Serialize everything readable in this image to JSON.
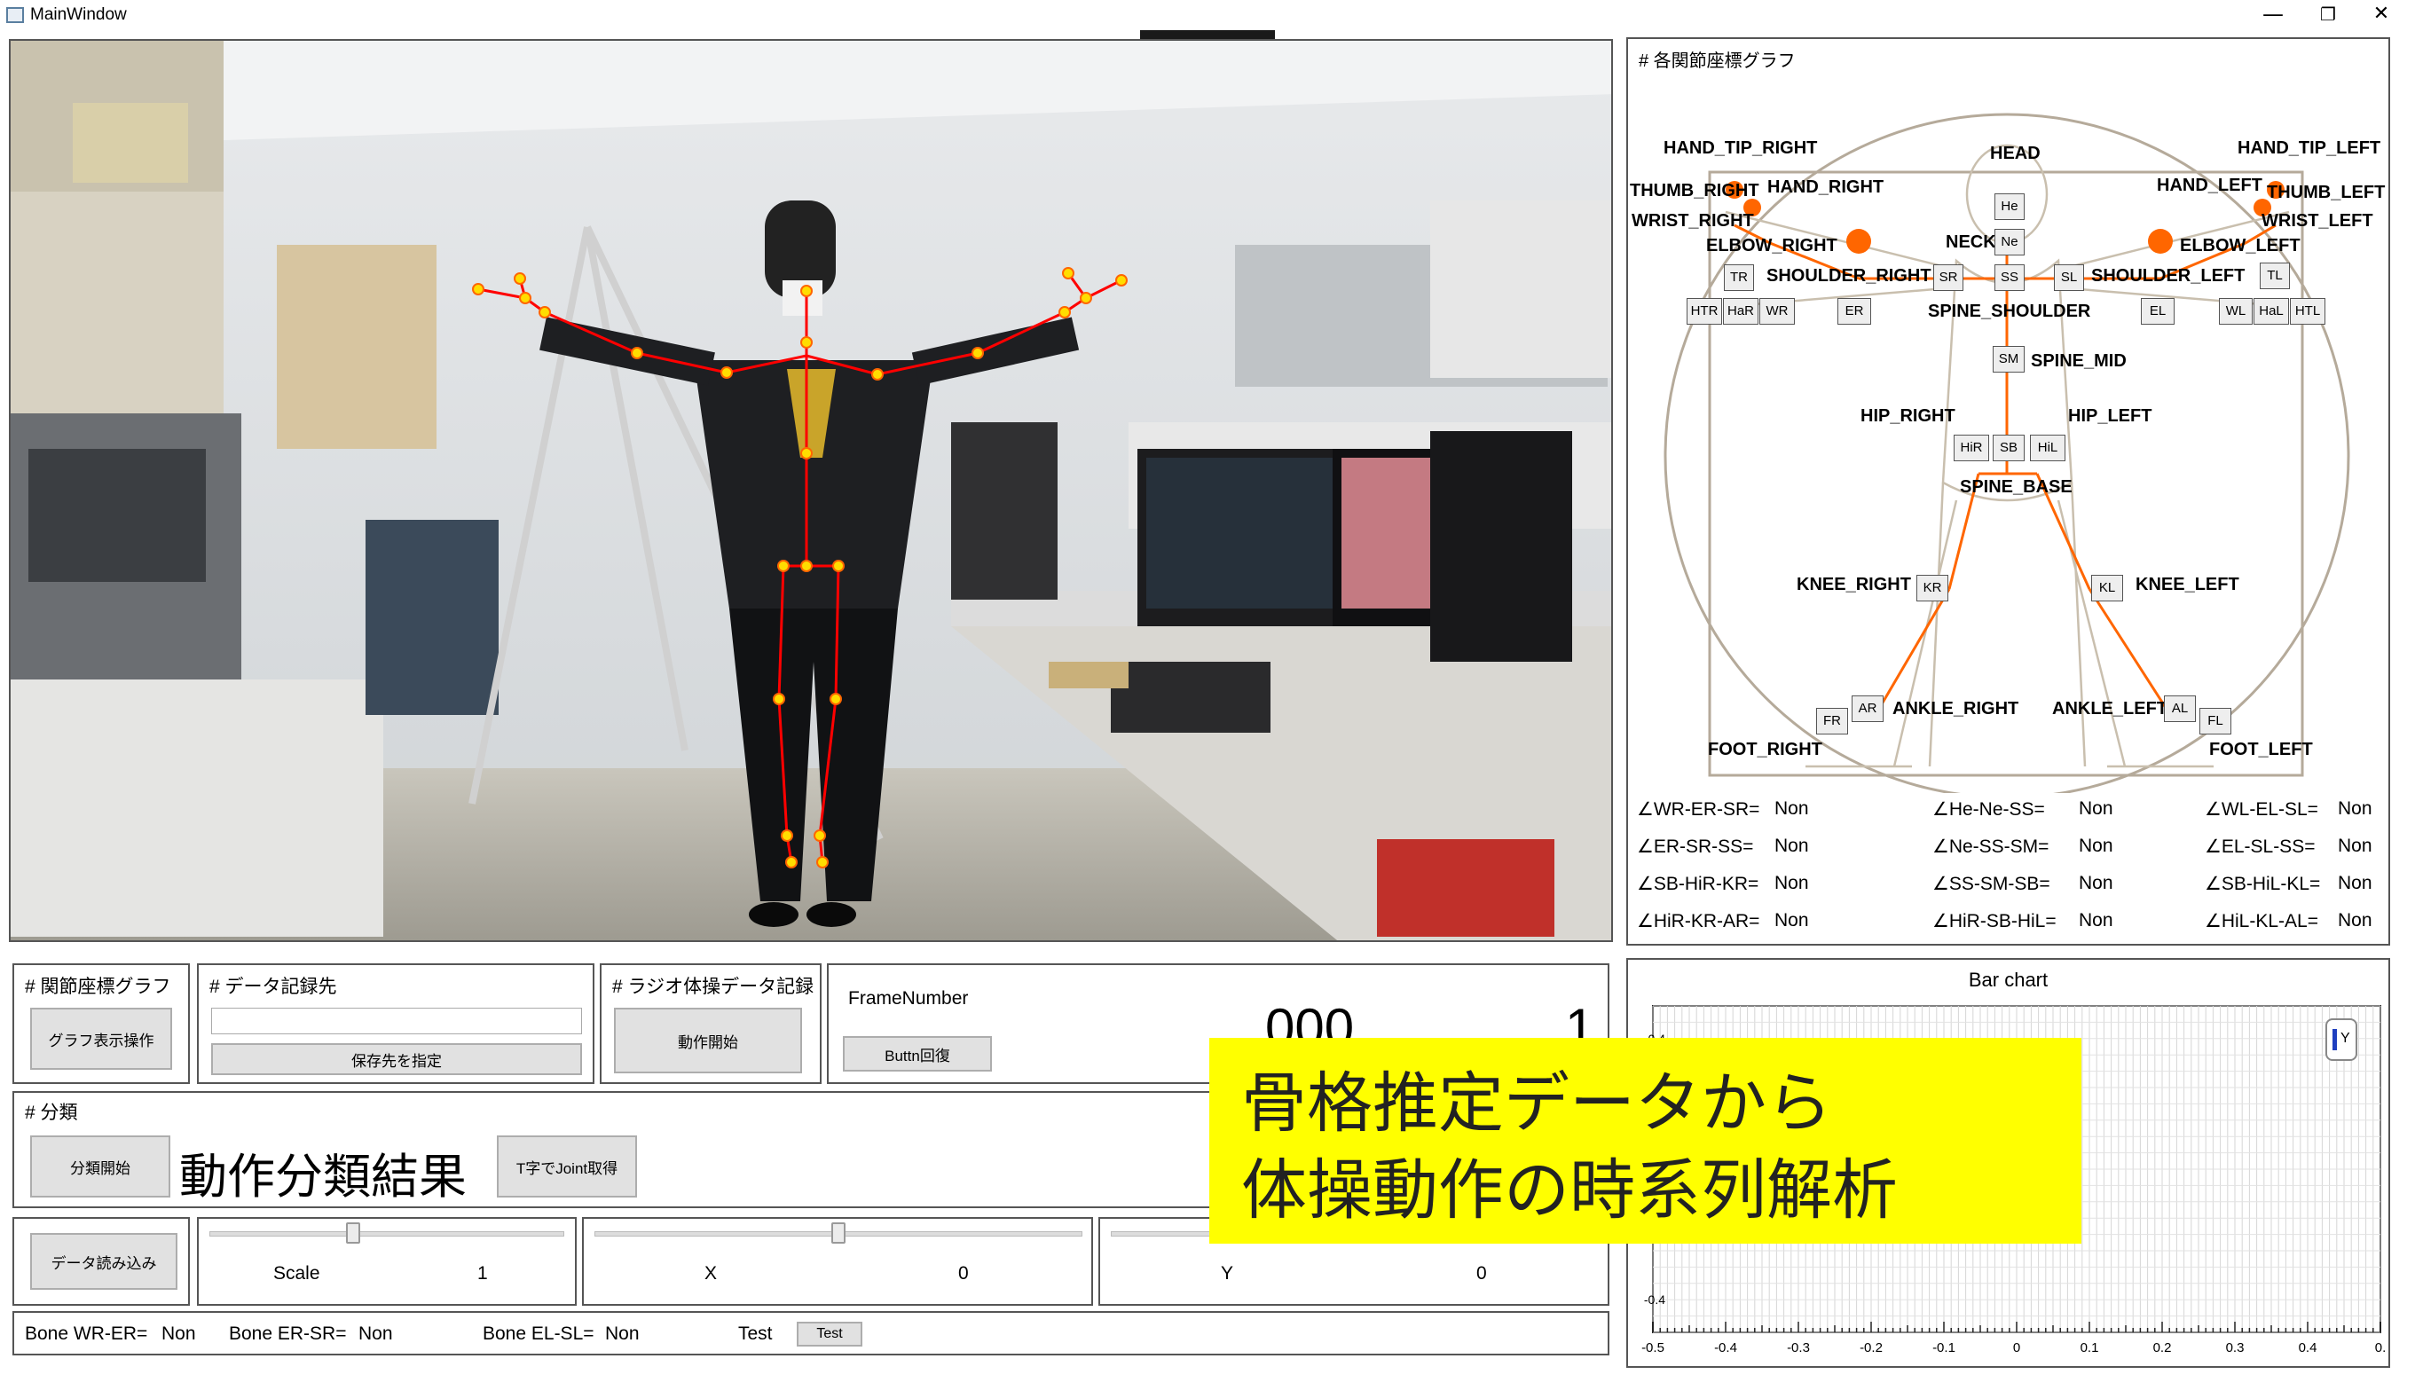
{
  "window": {
    "title": "MainWindow",
    "minimize": "—",
    "restore": "❐",
    "close": "✕"
  },
  "overlay": {
    "line1": "骨格推定データから",
    "line2": "体操動作の時系列解析",
    "bg": "#ffff00"
  },
  "joint_panel": {
    "header": "# 各関節座標グラフ",
    "labels": {
      "hand_tip_right": "HAND_TIP_RIGHT",
      "hand_tip_left": "HAND_TIP_LEFT",
      "head": "HEAD",
      "thumb_right": "THUMB_RIGHT",
      "hand_right": "HAND_RIGHT",
      "hand_left": "HAND_LEFT",
      "thumb_left": "THUMB_LEFT",
      "wrist_right": "WRIST_RIGHT",
      "wrist_left": "WRIST_LEFT",
      "neck": "NECK",
      "elbow_right": "ELBOW_RIGHT",
      "elbow_left": "ELBOW_LEFT",
      "shoulder_right": "SHOULDER_RIGHT",
      "shoulder_left": "SHOULDER_LEFT",
      "spine_shoulder": "SPINE_SHOULDER",
      "spine_mid": "SPINE_MID",
      "hip_right": "HIP_RIGHT",
      "hip_left": "HIP_LEFT",
      "spine_base": "SPINE_BASE",
      "knee_right": "KNEE_RIGHT",
      "knee_left": "KNEE_LEFT",
      "ankle_right": "ANKLE_RIGHT",
      "ankle_left": "ANKLE_LEFT",
      "foot_right": "FOOT_RIGHT",
      "foot_left": "FOOT_LEFT"
    },
    "boxes": {
      "he": "He",
      "ne": "Ne",
      "ss": "SS",
      "sr": "SR",
      "sl": "SL",
      "tr": "TR",
      "tl": "TL",
      "htr": "HTR",
      "har": "HaR",
      "wr": "WR",
      "er": "ER",
      "el": "EL",
      "wl": "WL",
      "hal": "HaL",
      "htl": "HTL",
      "sm": "SM",
      "hir": "HiR",
      "sb": "SB",
      "hil": "HiL",
      "kr": "KR",
      "kl": "KL",
      "ar": "AR",
      "al": "AL",
      "fr": "FR",
      "fl": "FL"
    },
    "angles": {
      "c1": [
        {
          "label": "∠WR-ER-SR=",
          "value": "Non"
        },
        {
          "label": "∠ER-SR-SS=",
          "value": "Non"
        },
        {
          "label": "∠SB-HiR-KR=",
          "value": "Non"
        },
        {
          "label": "∠HiR-KR-AR=",
          "value": "Non"
        }
      ],
      "c2": [
        {
          "label": "∠He-Ne-SS=",
          "value": "Non"
        },
        {
          "label": "∠Ne-SS-SM=",
          "value": "Non"
        },
        {
          "label": "∠SS-SM-SB=",
          "value": "Non"
        },
        {
          "label": "∠HiR-SB-HiL=",
          "value": "Non"
        }
      ],
      "c3": [
        {
          "label": "∠WL-EL-SL=",
          "value": "Non"
        },
        {
          "label": "∠EL-SL-SS=",
          "value": "Non"
        },
        {
          "label": "∠SB-HiL-KL=",
          "value": "Non"
        },
        {
          "label": "∠HiL-KL-AL=",
          "value": "Non"
        }
      ]
    },
    "bone_color": "#ff6600"
  },
  "controls": {
    "graph": {
      "header": "# 関節座標グラフ",
      "button": "グラフ表示操作"
    },
    "record": {
      "header": "# データ記録先",
      "input_value": "",
      "button": "保存先を指定"
    },
    "radio": {
      "header": "# ラジオ体操データ記録",
      "button": "動作開始"
    },
    "frame": {
      "label": "FrameNumber",
      "button": "Buttn回復",
      "value_left": "000",
      "value_right": "1"
    },
    "classify": {
      "header": "# 分類",
      "start_button": "分類開始",
      "result": "動作分類結果",
      "joint_button": "T字でJoint取得"
    },
    "load": {
      "button": "データ読み込み"
    },
    "scale": {
      "label": "Scale",
      "value": "1",
      "thumb": 0.4
    },
    "x": {
      "label": "X",
      "value": "0",
      "thumb": 0.5
    },
    "y": {
      "label": "Y",
      "value": "0",
      "thumb": 0.5
    },
    "status": {
      "b1_label": "Bone WR-ER=",
      "b1_value": "Non",
      "b2_label": "Bone ER-SR=",
      "b2_value": "Non",
      "b3_label": "Bone EL-SL=",
      "b3_value": "Non",
      "test_label": "Test",
      "test_button": "Test"
    }
  },
  "chart_data": {
    "type": "bar",
    "title": "Bar chart",
    "legend": [
      "Y"
    ],
    "legend_position": "top-right",
    "xlim": [
      -0.5,
      0.5
    ],
    "ylim": [
      -0.5,
      0.5
    ],
    "x_ticks": [
      "-0.5",
      "-0.4",
      "-0.3",
      "-0.2",
      "-0.1",
      "0",
      "0.1",
      "0.2",
      "0.3",
      "0.4",
      "0."
    ],
    "y_ticks": [
      "0.4",
      "-0.4"
    ],
    "grid": true,
    "series": [
      {
        "name": "Y",
        "values": []
      }
    ]
  }
}
